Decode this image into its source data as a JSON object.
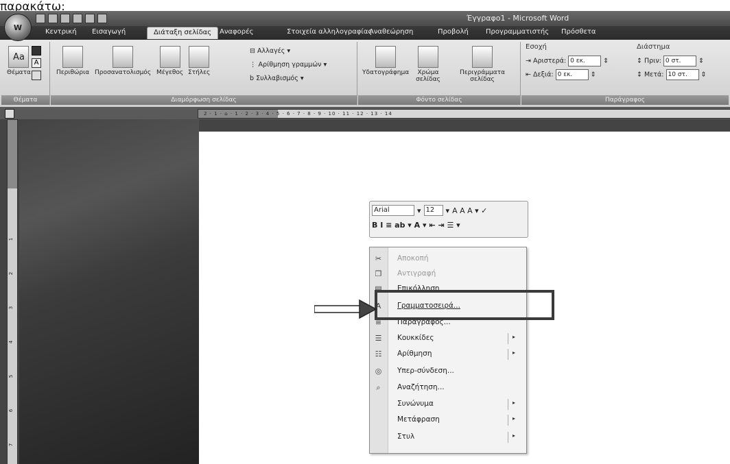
{
  "caption": "παρακάτω:",
  "window": {
    "title": "Έγγραφο1 - Microsoft Word",
    "office_button": "W"
  },
  "tabs": [
    "Κεντρική",
    "Εισαγωγή",
    "Διάταξη σελίδας",
    "Αναφορές",
    "Στοιχεία αλληλογραφίας",
    "Αναθεώρηση",
    "Προβολή",
    "Προγραμματιστής",
    "Πρόσθετα"
  ],
  "active_tab_index": 2,
  "ribbon": {
    "themes": {
      "label": "Θέματα",
      "icon_text": "Aa",
      "group_label": "Θέματα"
    },
    "page_setup": {
      "group_label": "Διαμόρφωση σελίδας",
      "buttons": [
        "Περιθώρια",
        "Προσανατολισμός",
        "Μέγεθος",
        "Στήλες"
      ],
      "small": [
        "Αλλαγές",
        "Αρίθμηση γραμμών",
        "Συλλαβισμός"
      ]
    },
    "page_background": {
      "group_label": "Φόντο σελίδας",
      "buttons": [
        "Υδατογράφημα",
        "Χρώμα σελίδας",
        "Περιγράμματα σελίδας"
      ]
    },
    "paragraph": {
      "group_label": "Παράγραφος",
      "indent_header": "Εσοχή",
      "left_label": "Αριστερά:",
      "left_value": "0 εκ.",
      "right_label": "Δεξιά:",
      "right_value": "0 εκ.",
      "spacing_header": "Διάστημα",
      "before_label": "Πριν:",
      "before_value": "0 στ.",
      "after_label": "Μετά:",
      "after_value": "10 στ."
    }
  },
  "mini_toolbar": {
    "font": "Arial",
    "size": "12",
    "row1_glyphs": "A  A  A ▾  ✓",
    "row2_glyphs": "B  I  ≡  ab ▾  A ▾  ⇤  ⇥  ☰ ▾"
  },
  "context_menu": {
    "items": [
      {
        "label": "Αποκοπή",
        "icon": "cut-icon",
        "glyph": "✂",
        "disabled": true,
        "submenu": false
      },
      {
        "label": "Αντιγραφή",
        "icon": "copy-icon",
        "glyph": "❐",
        "disabled": true,
        "submenu": false
      },
      {
        "label": "Επικόλληση",
        "icon": "paste-icon",
        "glyph": "▤",
        "disabled": false,
        "submenu": false
      },
      {
        "label": "Γραμματοσειρά...",
        "icon": "font-icon",
        "glyph": "A",
        "disabled": false,
        "submenu": false
      },
      {
        "label": "Παράγραφος...",
        "icon": "paragraph-icon",
        "glyph": "≡",
        "disabled": false,
        "submenu": false
      },
      {
        "label": "Κουκκίδες",
        "icon": "bullets-icon",
        "glyph": "☰",
        "disabled": false,
        "submenu": true
      },
      {
        "label": "Αρίθμηση",
        "icon": "numbering-icon",
        "glyph": "☷",
        "disabled": false,
        "submenu": true
      },
      {
        "label": "Υπερ-σύνδεση...",
        "icon": "hyperlink-icon",
        "glyph": "◎",
        "disabled": false,
        "submenu": false
      },
      {
        "label": "Αναζήτηση...",
        "icon": "lookup-icon",
        "glyph": "⌕",
        "disabled": false,
        "submenu": false
      },
      {
        "label": "Συνώνυμα",
        "icon": "",
        "glyph": "",
        "disabled": false,
        "submenu": true
      },
      {
        "label": "Μετάφραση",
        "icon": "",
        "glyph": "",
        "disabled": false,
        "submenu": true
      },
      {
        "label": "Στυλ",
        "icon": "",
        "glyph": "",
        "disabled": false,
        "submenu": true
      }
    ],
    "highlighted_index": 3
  },
  "ruler_numbers": "2 · 1 · ⌂ · 1 · 2 · 3 · 4 · 5 · 6 · 7 · 8 · 9 · 10 · 11 · 12 · 13 · 14",
  "vertical_ruler_ticks": [
    "1",
    "2",
    "3",
    "4",
    "5",
    "6",
    "7"
  ]
}
